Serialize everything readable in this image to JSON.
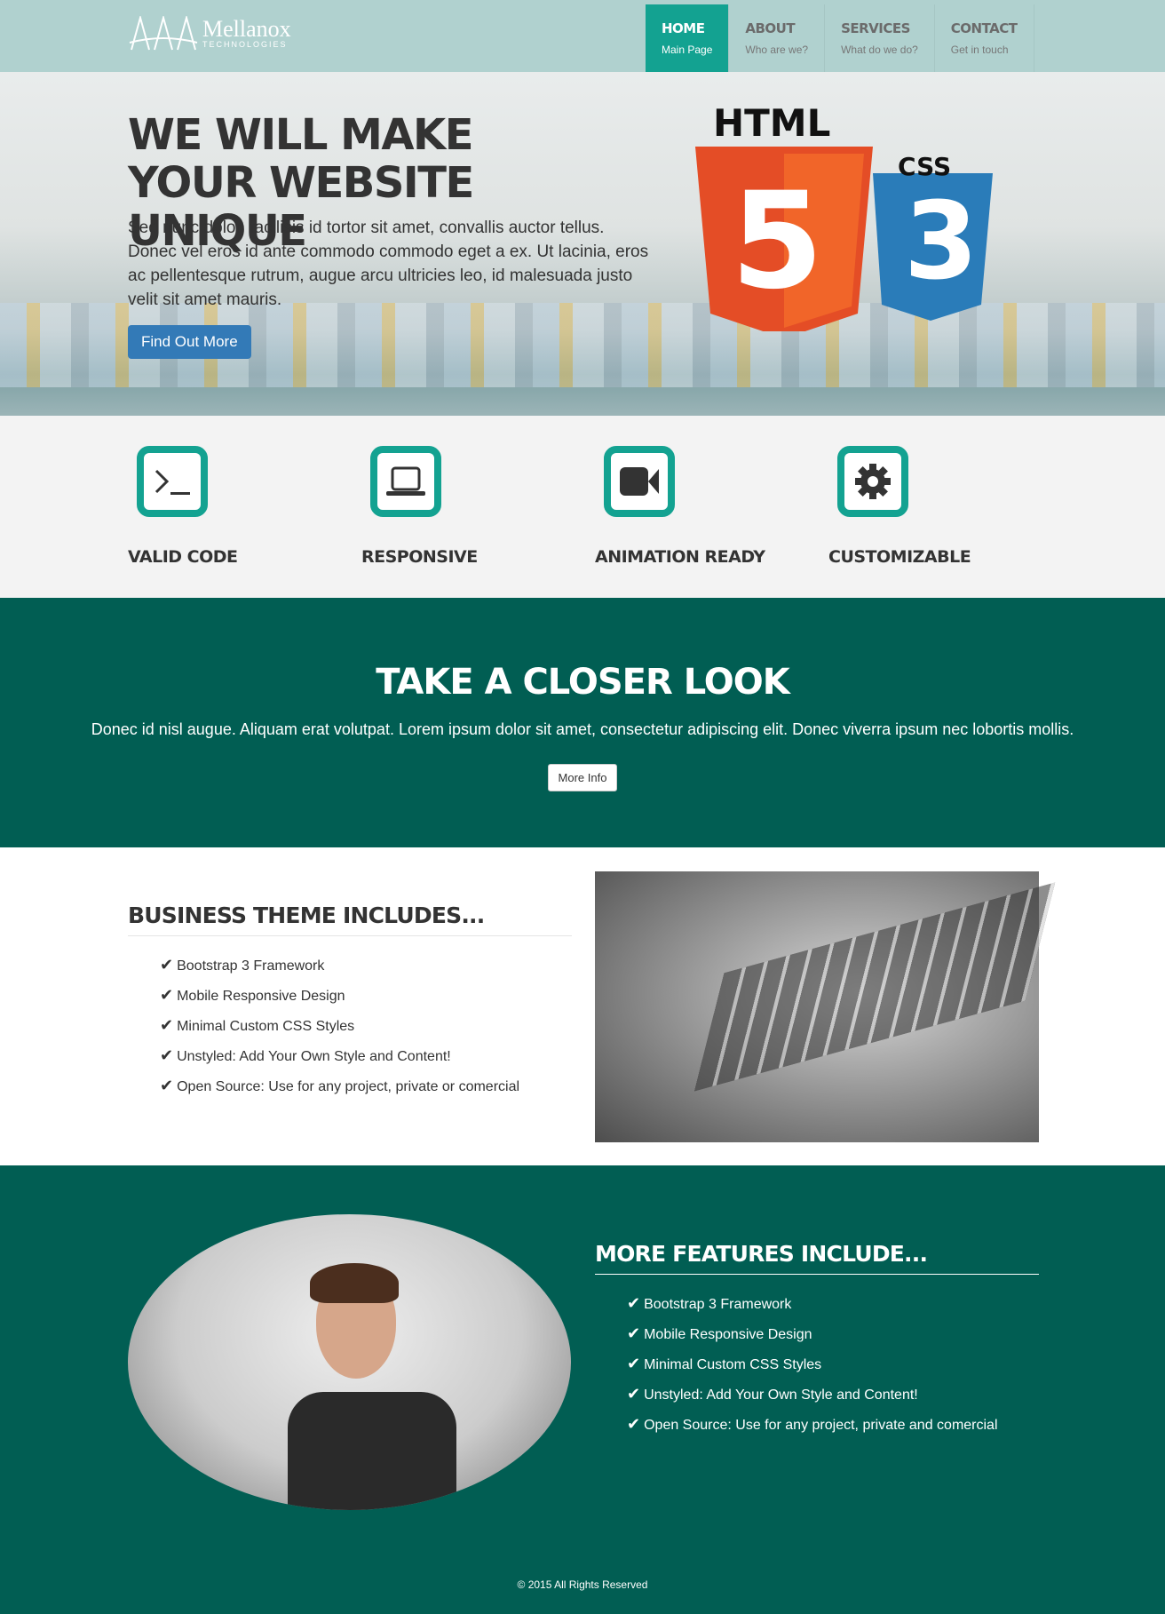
{
  "brand": {
    "name": "Mellanox",
    "sub": "TECHNOLOGIES"
  },
  "nav": [
    {
      "title": "HOME",
      "sub": "Main Page"
    },
    {
      "title": "ABOUT",
      "sub": "Who are we?"
    },
    {
      "title": "SERVICES",
      "sub": "What do we do?"
    },
    {
      "title": "CONTACT",
      "sub": "Get in touch"
    }
  ],
  "hero": {
    "title": "WE WILL MAKE YOUR WEBSITE UNIQUE",
    "text": "Sed nunc dolor, facilisis id tortor sit amet, convallis auctor tellus. Donec vel eros id ante commodo commodo eget a ex. Ut lacinia, eros ac pellentesque rutrum, augue arcu ultricies leo, id malesuada justo velit sit amet mauris.",
    "button": "Find Out More",
    "logo_html": "HTML",
    "logo_css": "CSS",
    "logo_5": "5",
    "logo_3": "3"
  },
  "features": [
    {
      "label": "VALID CODE",
      "icon": "terminal-icon"
    },
    {
      "label": "RESPONSIVE",
      "icon": "laptop-icon"
    },
    {
      "label": "ANIMATION READY",
      "icon": "video-camera-icon"
    },
    {
      "label": "CUSTOMIZABLE",
      "icon": "gear-icon"
    }
  ],
  "closer": {
    "title": "TAKE A CLOSER LOOK",
    "text": "Donec id nisl augue. Aliquam erat volutpat. Lorem ipsum dolor sit amet, consectetur adipiscing elit. Donec viverra ipsum nec lobortis mollis.",
    "button": "More Info"
  },
  "business": {
    "title": "BUSINESS THEME INCLUDES...",
    "items": [
      "Bootstrap 3 Framework",
      "Mobile Responsive Design",
      "Minimal Custom CSS Styles",
      "Unstyled: Add Your Own Style and Content!",
      "Open Source: Use for any project, private or comercial"
    ]
  },
  "more": {
    "title": "MORE FEATURES INCLUDE...",
    "items": [
      "Bootstrap 3 Framework",
      "Mobile Responsive Design",
      "Minimal Custom CSS Styles",
      "Unstyled: Add Your Own Style and Content!",
      "Open Source: Use for any project, private and comercial"
    ]
  },
  "footer": "© 2015 All Rights Reserved",
  "colors": {
    "nav_bg": "#b0d1cf",
    "accent": "#13a291",
    "dark_teal": "#015e53",
    "button_blue": "#337ab7"
  }
}
